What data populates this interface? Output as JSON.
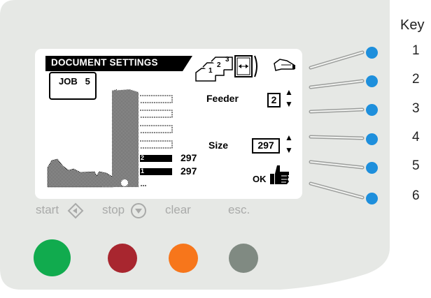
{
  "lcd": {
    "title": "DOCUMENT SETTINGS",
    "job_label": "JOB",
    "job_number": "5",
    "feeder_label": "Feeder",
    "feeder_value": "2",
    "size_label": "Size",
    "size_value": "297",
    "ok_label": "OK",
    "doc_rows": [
      {
        "index": "2",
        "value": "297"
      },
      {
        "index": "1",
        "value": "297"
      }
    ],
    "fold_icon_numbers": [
      "1",
      "2",
      "3"
    ]
  },
  "buttons": {
    "start": {
      "label": "start",
      "color": "#11ab4e"
    },
    "stop": {
      "label": "stop",
      "color": "#a8262f"
    },
    "clear": {
      "label": "clear",
      "color": "#f7761b"
    },
    "esc": {
      "label": "esc.",
      "color": "#808a82"
    }
  },
  "side_buttons_color": "#1e8fdc",
  "key": {
    "title": "Key",
    "numbers": [
      "1",
      "2",
      "3",
      "4",
      "5",
      "6"
    ]
  },
  "colors": {
    "panel": "#e6e8e5",
    "label_gray": "#a9aaa9",
    "lcd_background": "#ffffff"
  }
}
